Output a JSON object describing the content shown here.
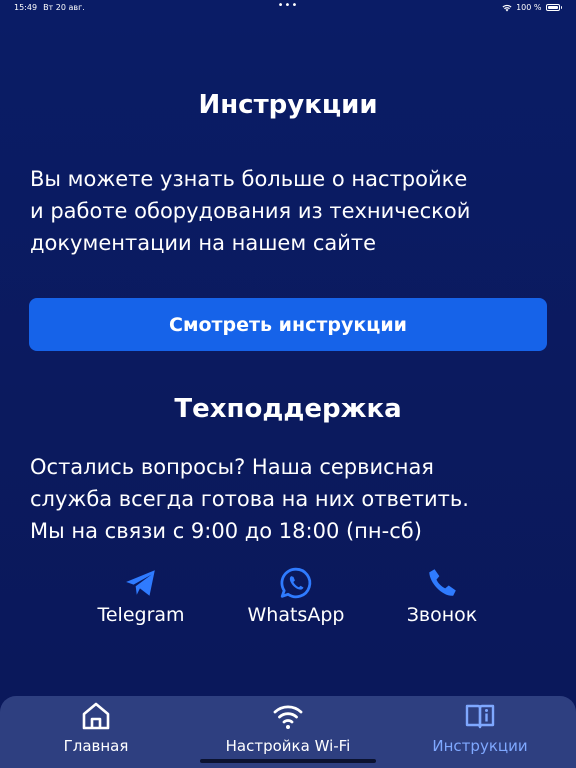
{
  "status_bar": {
    "time": "15:49",
    "date": "Вт 20 авг.",
    "dots": "•••",
    "battery_text": "100 %"
  },
  "instructions": {
    "title": "Инструкции",
    "text_lines": [
      "Вы можете узнать больше о настройке",
      "и работе оборудования из технической",
      "документации на нашем сайте"
    ],
    "button_label": "Смотреть инструкции"
  },
  "support": {
    "title": "Техподдержка",
    "text_lines": [
      "Остались вопросы? Наша сервисная",
      "служба всегда готова на них ответить.",
      "Мы на связи с 9:00 до 18:00 (пн-сб)"
    ],
    "contacts": [
      {
        "label": "Telegram",
        "icon": "telegram-icon"
      },
      {
        "label": "WhatsApp",
        "icon": "whatsapp-icon"
      },
      {
        "label": "Звонок",
        "icon": "phone-icon"
      }
    ]
  },
  "tab_bar": {
    "tabs": [
      {
        "label": "Главная",
        "icon": "home-icon"
      },
      {
        "label": "Настройка Wi-Fi",
        "icon": "wifi-icon"
      },
      {
        "label": "Инструкции",
        "icon": "book-info-icon",
        "active": true
      }
    ]
  },
  "colors": {
    "background": "#0a1c66",
    "button": "#1663e9",
    "accent_icon": "#2f7bff",
    "tab_bar": "#2e3f80",
    "active_tab": "#7fa8ff"
  }
}
